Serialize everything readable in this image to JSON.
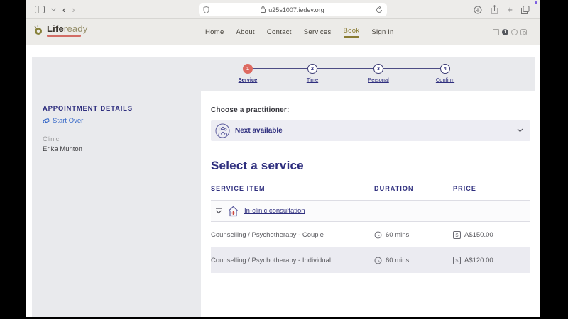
{
  "browser": {
    "url": "u25s1007.iedev.org",
    "toolbar": {
      "new_tab_label": "+"
    }
  },
  "site": {
    "logo": {
      "bold": "Life",
      "light": "ready"
    },
    "nav": [
      {
        "label": "Home",
        "active": false
      },
      {
        "label": "About",
        "active": false
      },
      {
        "label": "Contact",
        "active": false
      },
      {
        "label": "Services",
        "active": false
      },
      {
        "label": "Book",
        "active": true
      },
      {
        "label": "Sign in",
        "active": false
      }
    ],
    "social": [
      "news",
      "facebook",
      "linkedin",
      "instagram"
    ]
  },
  "stepper": {
    "steps": [
      {
        "num": "1",
        "label": "Service",
        "active": true
      },
      {
        "num": "2",
        "label": "Time",
        "active": false
      },
      {
        "num": "3",
        "label": "Personal",
        "active": false
      },
      {
        "num": "4",
        "label": "Confirm",
        "active": false
      }
    ]
  },
  "sidebar": {
    "title": "APPOINTMENT DETAILS",
    "start_over": "Start Over",
    "clinic_label": "Clinic",
    "clinic_value": "Erika Munton"
  },
  "main": {
    "practitioner_label": "Choose a practitioner:",
    "practitioner_value": "Next available",
    "service_heading": "Select a service",
    "table": {
      "headers": [
        "SERVICE ITEM",
        "DURATION",
        "PRICE"
      ],
      "category": "In-clinic consultation",
      "rows": [
        {
          "name": "Counselling / Psychotherapy - Couple",
          "duration": "60 mins",
          "price": "A$150.00"
        },
        {
          "name": "Counselling / Psychotherapy - Individual",
          "duration": "60 mins",
          "price": "A$120.00"
        }
      ]
    }
  },
  "colors": {
    "navy": "#2e2e7e",
    "coral": "#dd6a61",
    "link_blue": "#3a6bc9",
    "widget_bg": "#e9eaed",
    "alt_row_bg": "#ebebf1",
    "header_bg": "#ecebe8",
    "nav_active": "#8a7c33",
    "tagline_red": "#c9423a"
  }
}
